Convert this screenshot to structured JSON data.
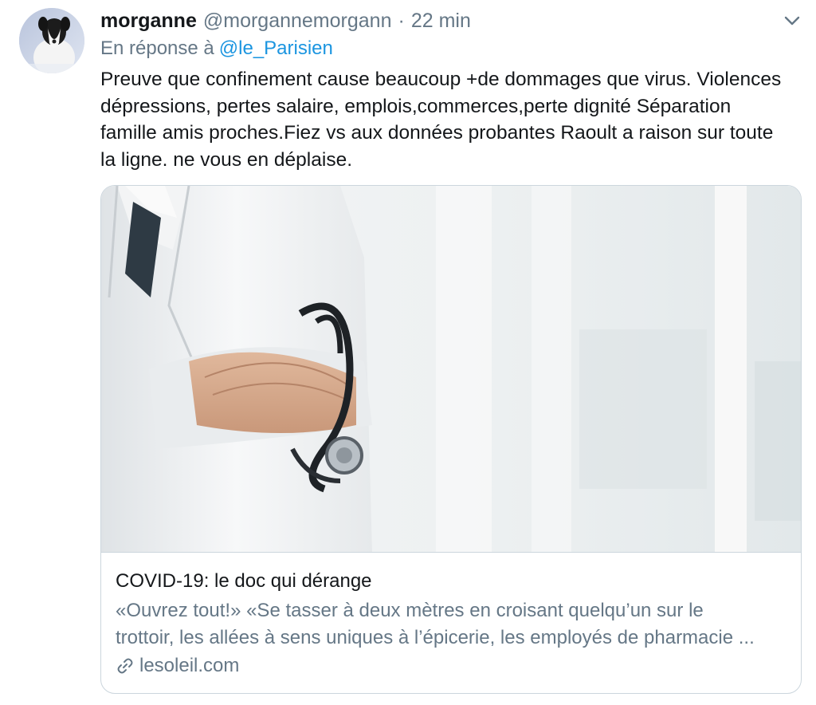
{
  "tweet": {
    "author_name": "morganne",
    "author_handle": "@morgannemorgann",
    "separator": "·",
    "time": "22 min",
    "reply_prefix": "En réponse à",
    "reply_to": "@le_Parisien",
    "text_lines": [
      "Preuve que confinement cause beaucoup +de dommages que virus. Violences",
      "dépressions, pertes salaire, emplois,commerces,perte dignité Séparation",
      "famille amis proches.Fiez vs aux données probantes Raoult a raison sur toute",
      "la ligne. ne vous en déplaise."
    ]
  },
  "card": {
    "title": "COVID-19: le doc qui dérange",
    "description_lines": [
      "«Ouvrez tout!» «Se tasser à deux mètres en croisant quelqu’un sur le",
      "trottoir, les allées à sens uniques à l’épicerie, les employés de pharmacie ..."
    ],
    "domain": "lesoleil.com"
  },
  "icons": {
    "caret": "chevron-down-icon",
    "link": "link-icon"
  },
  "colors": {
    "text_primary": "#14171a",
    "text_secondary": "#657786",
    "link": "#1b95e0",
    "border": "#ccd6dd"
  }
}
